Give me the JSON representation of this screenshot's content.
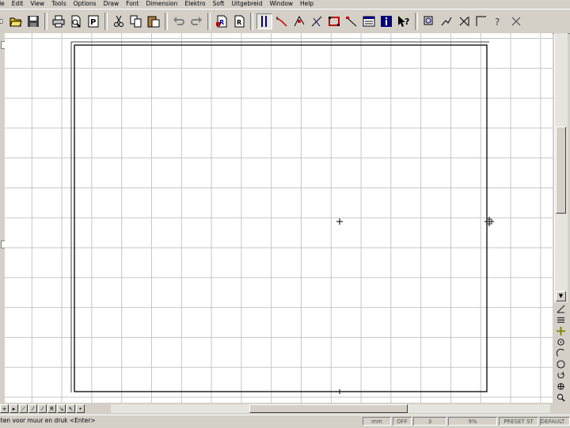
{
  "menu": [
    "ile",
    "Edit",
    "View",
    "Tools",
    "Options",
    "Draw",
    "Font",
    "Dimension",
    "Elektro",
    "Soft",
    "Uitgebreid",
    "Window",
    "Help"
  ],
  "status": {
    "prompt": "nten voor muur en druk <Enter>",
    "units": "mm",
    "snap": "OFF",
    "layer": "3",
    "zoom": "9%",
    "preset": "PRESET ST",
    "style": "DEFAULT"
  },
  "tabs": [
    "+",
    "▸",
    "⟋",
    "⁄",
    "⁄",
    "R",
    "↘",
    "↖",
    "•"
  ],
  "colors": {
    "accent_red": "#c00000",
    "accent_blue": "#000080",
    "grid": "#c6c6c6"
  }
}
